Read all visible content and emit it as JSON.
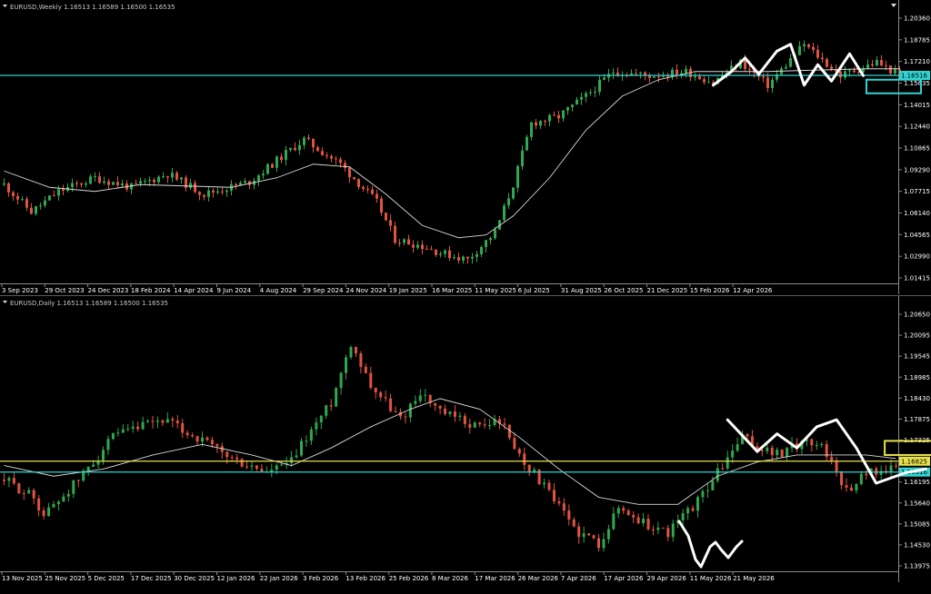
{
  "colors": {
    "background": "#000000",
    "bull": "#2fa84f",
    "bear": "#e2533f",
    "ma": "#d8d8d8",
    "cyan": "#31d3d3",
    "yellow": "#e8e24a",
    "drawing": "#ffffff",
    "axis": "#8a8a8a"
  },
  "chart_data": [
    {
      "type": "candlestick",
      "title": "EURUSD,Weekly  1.16513 1.16589 1.16500 1.16535",
      "y_ticks": [
        "1.20360",
        "1.18785",
        "1.17210",
        "1.15635",
        "1.14015",
        "1.12440",
        "1.10865",
        "1.09290",
        "1.07715",
        "1.06140",
        "1.04565",
        "1.02990",
        "1.01415"
      ],
      "x_ticks": [
        "3 Sep 2023",
        "29 Oct 2023",
        "24 Dec 2023",
        "18 Feb 2024",
        "14 Apr 2024",
        "9 Jun 2024",
        "4 Aug 2024",
        "29 Sep 2024",
        "24 Nov 2024",
        "19 Jan 2025",
        "16 Mar 2025",
        "11 May 2025",
        "6 Jul 2025",
        "31 Aug 2025",
        "26 Oct 2025",
        "21 Dec 2025",
        "15 Feb 2026",
        "12 Apr 2026"
      ],
      "ylim": [
        1.0125,
        1.2125
      ],
      "close_path": [
        [
          0,
          1.085
        ],
        [
          6,
          1.065
        ],
        [
          12,
          1.08
        ],
        [
          20,
          1.09
        ],
        [
          28,
          1.083
        ],
        [
          36,
          1.093
        ],
        [
          44,
          1.078
        ],
        [
          54,
          1.087
        ],
        [
          62,
          1.108
        ],
        [
          66,
          1.118
        ],
        [
          74,
          1.1
        ],
        [
          82,
          1.072
        ],
        [
          86,
          1.045
        ],
        [
          92,
          1.04
        ],
        [
          96,
          1.035
        ],
        [
          102,
          1.03
        ],
        [
          108,
          1.05
        ],
        [
          112,
          1.085
        ],
        [
          116,
          1.13
        ],
        [
          122,
          1.135
        ],
        [
          128,
          1.15
        ],
        [
          134,
          1.168
        ],
        [
          142,
          1.165
        ],
        [
          150,
          1.168
        ],
        [
          156,
          1.16
        ],
        [
          162,
          1.175
        ],
        [
          168,
          1.158
        ],
        [
          176,
          1.188
        ],
        [
          184,
          1.165
        ],
        [
          192,
          1.175
        ],
        [
          197,
          1.165
        ]
      ],
      "ma_path": [
        [
          0,
          1.095
        ],
        [
          10,
          1.083
        ],
        [
          20,
          1.08
        ],
        [
          30,
          1.085
        ],
        [
          40,
          1.084
        ],
        [
          50,
          1.083
        ],
        [
          60,
          1.09
        ],
        [
          68,
          1.1
        ],
        [
          76,
          1.098
        ],
        [
          84,
          1.078
        ],
        [
          92,
          1.055
        ],
        [
          100,
          1.046
        ],
        [
          106,
          1.048
        ],
        [
          112,
          1.062
        ],
        [
          120,
          1.09
        ],
        [
          128,
          1.125
        ],
        [
          136,
          1.15
        ],
        [
          144,
          1.162
        ],
        [
          152,
          1.168
        ],
        [
          160,
          1.168
        ],
        [
          168,
          1.168
        ],
        [
          178,
          1.169
        ],
        [
          190,
          1.17
        ],
        [
          197,
          1.17
        ]
      ],
      "horizontal_lines": [
        {
          "price": 1.16516,
          "label": "1.16516",
          "color": "cyan"
        }
      ],
      "annotations": {
        "drawn_path": [
          [
            156,
            1.158
          ],
          [
            160,
            1.168
          ],
          [
            163,
            1.178
          ],
          [
            166,
            1.166
          ],
          [
            170,
            1.183
          ],
          [
            173,
            1.188
          ],
          [
            176,
            1.158
          ],
          [
            179,
            1.173
          ],
          [
            182,
            1.161
          ],
          [
            186,
            1.181
          ],
          [
            189,
            1.165
          ]
        ],
        "box": {
          "x0": 190,
          "x1": 202,
          "y0": 1.152,
          "y1": 1.162,
          "color": "cyan"
        }
      }
    },
    {
      "type": "candlestick",
      "title": "EURUSD,Daily  1.16513 1.16589 1.16500 1.16535",
      "y_ticks": [
        "1.20650",
        "1.20095",
        "1.19545",
        "1.18985",
        "1.18430",
        "1.17875",
        "1.17325",
        "1.16770",
        "1.16195",
        "1.15640",
        "1.15085",
        "1.14530",
        "1.13975"
      ],
      "x_ticks": [
        "13 Nov 2025",
        "25 Nov 2025",
        "5 Dec 2025",
        "17 Dec 2025",
        "30 Dec 2025",
        "12 Jan 2026",
        "22 Jan 2026",
        "3 Feb 2026",
        "13 Feb 2026",
        "25 Feb 2026",
        "8 Mar 2026",
        "17 Mar 2026",
        "26 Mar 2026",
        "7 Apr 2026",
        "17 Apr 2026",
        "29 Apr 2026",
        "11 May 2026",
        "21 May 2026"
      ],
      "ylim": [
        1.137,
        1.212
      ],
      "close_path": [
        [
          0,
          1.163
        ],
        [
          6,
          1.158
        ],
        [
          8,
          1.153
        ],
        [
          15,
          1.163
        ],
        [
          22,
          1.175
        ],
        [
          32,
          1.18
        ],
        [
          40,
          1.174
        ],
        [
          47,
          1.168
        ],
        [
          53,
          1.165
        ],
        [
          58,
          1.168
        ],
        [
          60,
          1.173
        ],
        [
          66,
          1.185
        ],
        [
          70,
          1.202
        ],
        [
          74,
          1.19
        ],
        [
          80,
          1.18
        ],
        [
          84,
          1.188
        ],
        [
          88,
          1.182
        ],
        [
          96,
          1.178
        ],
        [
          100,
          1.18
        ],
        [
          104,
          1.17
        ],
        [
          108,
          1.163
        ],
        [
          112,
          1.155
        ],
        [
          116,
          1.148
        ],
        [
          120,
          1.145
        ],
        [
          124,
          1.155
        ],
        [
          130,
          1.15
        ],
        [
          134,
          1.148
        ],
        [
          140,
          1.157
        ],
        [
          144,
          1.165
        ],
        [
          149,
          1.175
        ],
        [
          152,
          1.172
        ],
        [
          157,
          1.17
        ],
        [
          161,
          1.174
        ],
        [
          165,
          1.173
        ],
        [
          170,
          1.16
        ],
        [
          174,
          1.165
        ],
        [
          178,
          1.166
        ],
        [
          180,
          1.166
        ]
      ],
      "ma_path": [
        [
          0,
          1.167
        ],
        [
          10,
          1.164
        ],
        [
          20,
          1.166
        ],
        [
          30,
          1.17
        ],
        [
          40,
          1.173
        ],
        [
          50,
          1.17
        ],
        [
          58,
          1.167
        ],
        [
          66,
          1.172
        ],
        [
          74,
          1.178
        ],
        [
          82,
          1.183
        ],
        [
          88,
          1.186
        ],
        [
          96,
          1.183
        ],
        [
          104,
          1.175
        ],
        [
          112,
          1.166
        ],
        [
          120,
          1.158
        ],
        [
          128,
          1.156
        ],
        [
          136,
          1.156
        ],
        [
          144,
          1.164
        ],
        [
          152,
          1.168
        ],
        [
          160,
          1.17
        ],
        [
          168,
          1.17
        ],
        [
          174,
          1.17
        ],
        [
          180,
          1.169
        ]
      ],
      "horizontal_lines": [
        {
          "price": 1.16825,
          "label": "1.16825",
          "color": "yellow"
        },
        {
          "price": 1.16516,
          "label": "1.16516",
          "color": "cyan"
        }
      ],
      "annotations": {
        "drawn_path": [
          [
            146,
            1.18
          ],
          [
            152,
            1.171
          ],
          [
            156,
            1.176
          ],
          [
            160,
            1.172
          ],
          [
            164,
            1.178
          ],
          [
            168,
            1.18
          ],
          [
            172,
            1.172
          ],
          [
            176,
            1.162
          ],
          [
            182,
            1.165
          ],
          [
            186,
            1.166
          ]
        ],
        "box": {
          "x0": 178,
          "x1": 189,
          "y0": 1.17,
          "y1": 1.174,
          "color": "yellow"
        },
        "w_sketch": [
          [
            747,
            574
          ],
          [
            757,
            590
          ],
          [
            765,
            616
          ],
          [
            771,
            624
          ],
          [
            781,
            602
          ],
          [
            787,
            597
          ],
          [
            793,
            605
          ],
          [
            801,
            614
          ],
          [
            810,
            602
          ],
          [
            816,
            596
          ]
        ]
      }
    }
  ]
}
